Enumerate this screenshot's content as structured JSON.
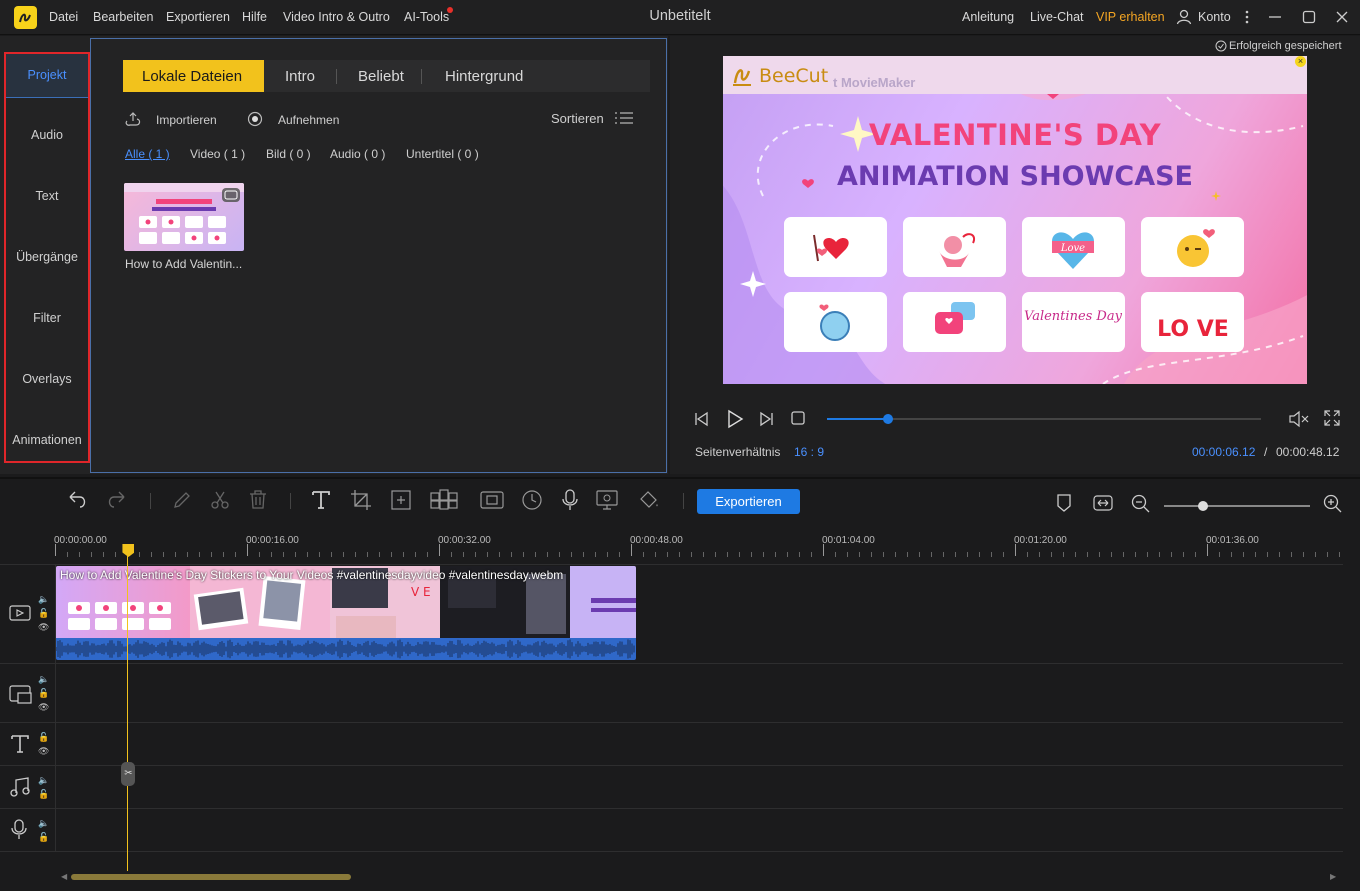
{
  "titlebar": {
    "menu": [
      "Datei",
      "Bearbeiten",
      "Exportieren",
      "Hilfe",
      "Video Intro & Outro",
      "AI-Tools"
    ],
    "title": "Unbetitelt",
    "right": {
      "guide": "Anleitung",
      "chat": "Live-Chat",
      "vip": "VIP erhalten",
      "account": "Konto"
    }
  },
  "sidebar": {
    "items": [
      "Projekt",
      "Audio",
      "Text",
      "Übergänge",
      "Filter",
      "Overlays",
      "Animationen"
    ],
    "active": "Projekt"
  },
  "media": {
    "tabs": [
      "Lokale Dateien",
      "Intro",
      "Beliebt",
      "Hintergrund"
    ],
    "import_label": "Importieren",
    "record_label": "Aufnehmen",
    "sort_label": "Sortieren",
    "filters": [
      "Alle ( 1 )",
      "Video ( 1 )",
      "Bild ( 0 )",
      "Audio ( 0 )",
      "Untertitel ( 0 )"
    ],
    "file": {
      "name": "How to Add Valentin..."
    }
  },
  "preview": {
    "saved": "Erfolgreich gespeichert",
    "brand": "BeeCut",
    "brand_faded": "t MovieMaker",
    "headline1": "VALENTINE'S DAY",
    "headline2": "ANIMATION SHOWCASE",
    "aspect_label": "Seitenverhältnis",
    "aspect_value": "16 : 9",
    "current_time": "00:00:06.12",
    "time_sep": "/",
    "total_time": "00:00:48.12",
    "progress": 0.14,
    "card_texts": [
      "Love",
      "Valentines Day",
      "LO VE"
    ]
  },
  "timeline": {
    "export_label": "Exportieren",
    "ruler": [
      "00:00:00.00",
      "00:00:16.00",
      "00:00:32.00",
      "00:00:48.00",
      "00:01:04.00",
      "00:01:20.00",
      "00:01:36.00"
    ],
    "clip_title": "How to Add Valentine's Day Stickers to Your Videos #valentinesdayvideo #valentinesday.webm",
    "playhead_seconds": 6.12,
    "track_icons": [
      "video-track-icon",
      "overlay-track-icon",
      "text-track-icon",
      "music-track-icon",
      "voice-track-icon"
    ]
  },
  "colors": {
    "accent": "#f2c21c",
    "blue": "#1e7ae3",
    "highlight": "#4a90ff",
    "vip": "#f5a623",
    "red_outline": "#e0262a"
  }
}
